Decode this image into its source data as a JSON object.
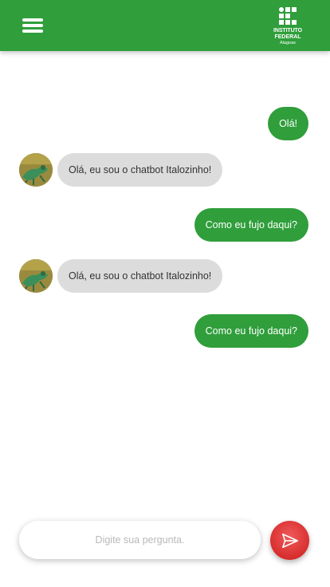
{
  "header": {
    "menu_icon": "hamburger-menu-icon",
    "logo": {
      "line1": "INSTITUTO",
      "line2": "FEDERAL",
      "line3": "Alagoas"
    },
    "color": "#2f9e3b"
  },
  "messages": [
    {
      "sender": "user",
      "text": "Olá!"
    },
    {
      "sender": "bot",
      "text": "Olá, eu sou o chatbot Italozinho!"
    },
    {
      "sender": "user",
      "text": "Como eu fujo daqui?"
    },
    {
      "sender": "bot",
      "text": "Olá, eu sou o chatbot Italozinho!"
    },
    {
      "sender": "user",
      "text": "Como eu fujo daqui?"
    }
  ],
  "input": {
    "placeholder": "Digite sua pergunta.",
    "value": ""
  },
  "send_button": {
    "icon": "send-icon",
    "color": "#d62b2b"
  }
}
